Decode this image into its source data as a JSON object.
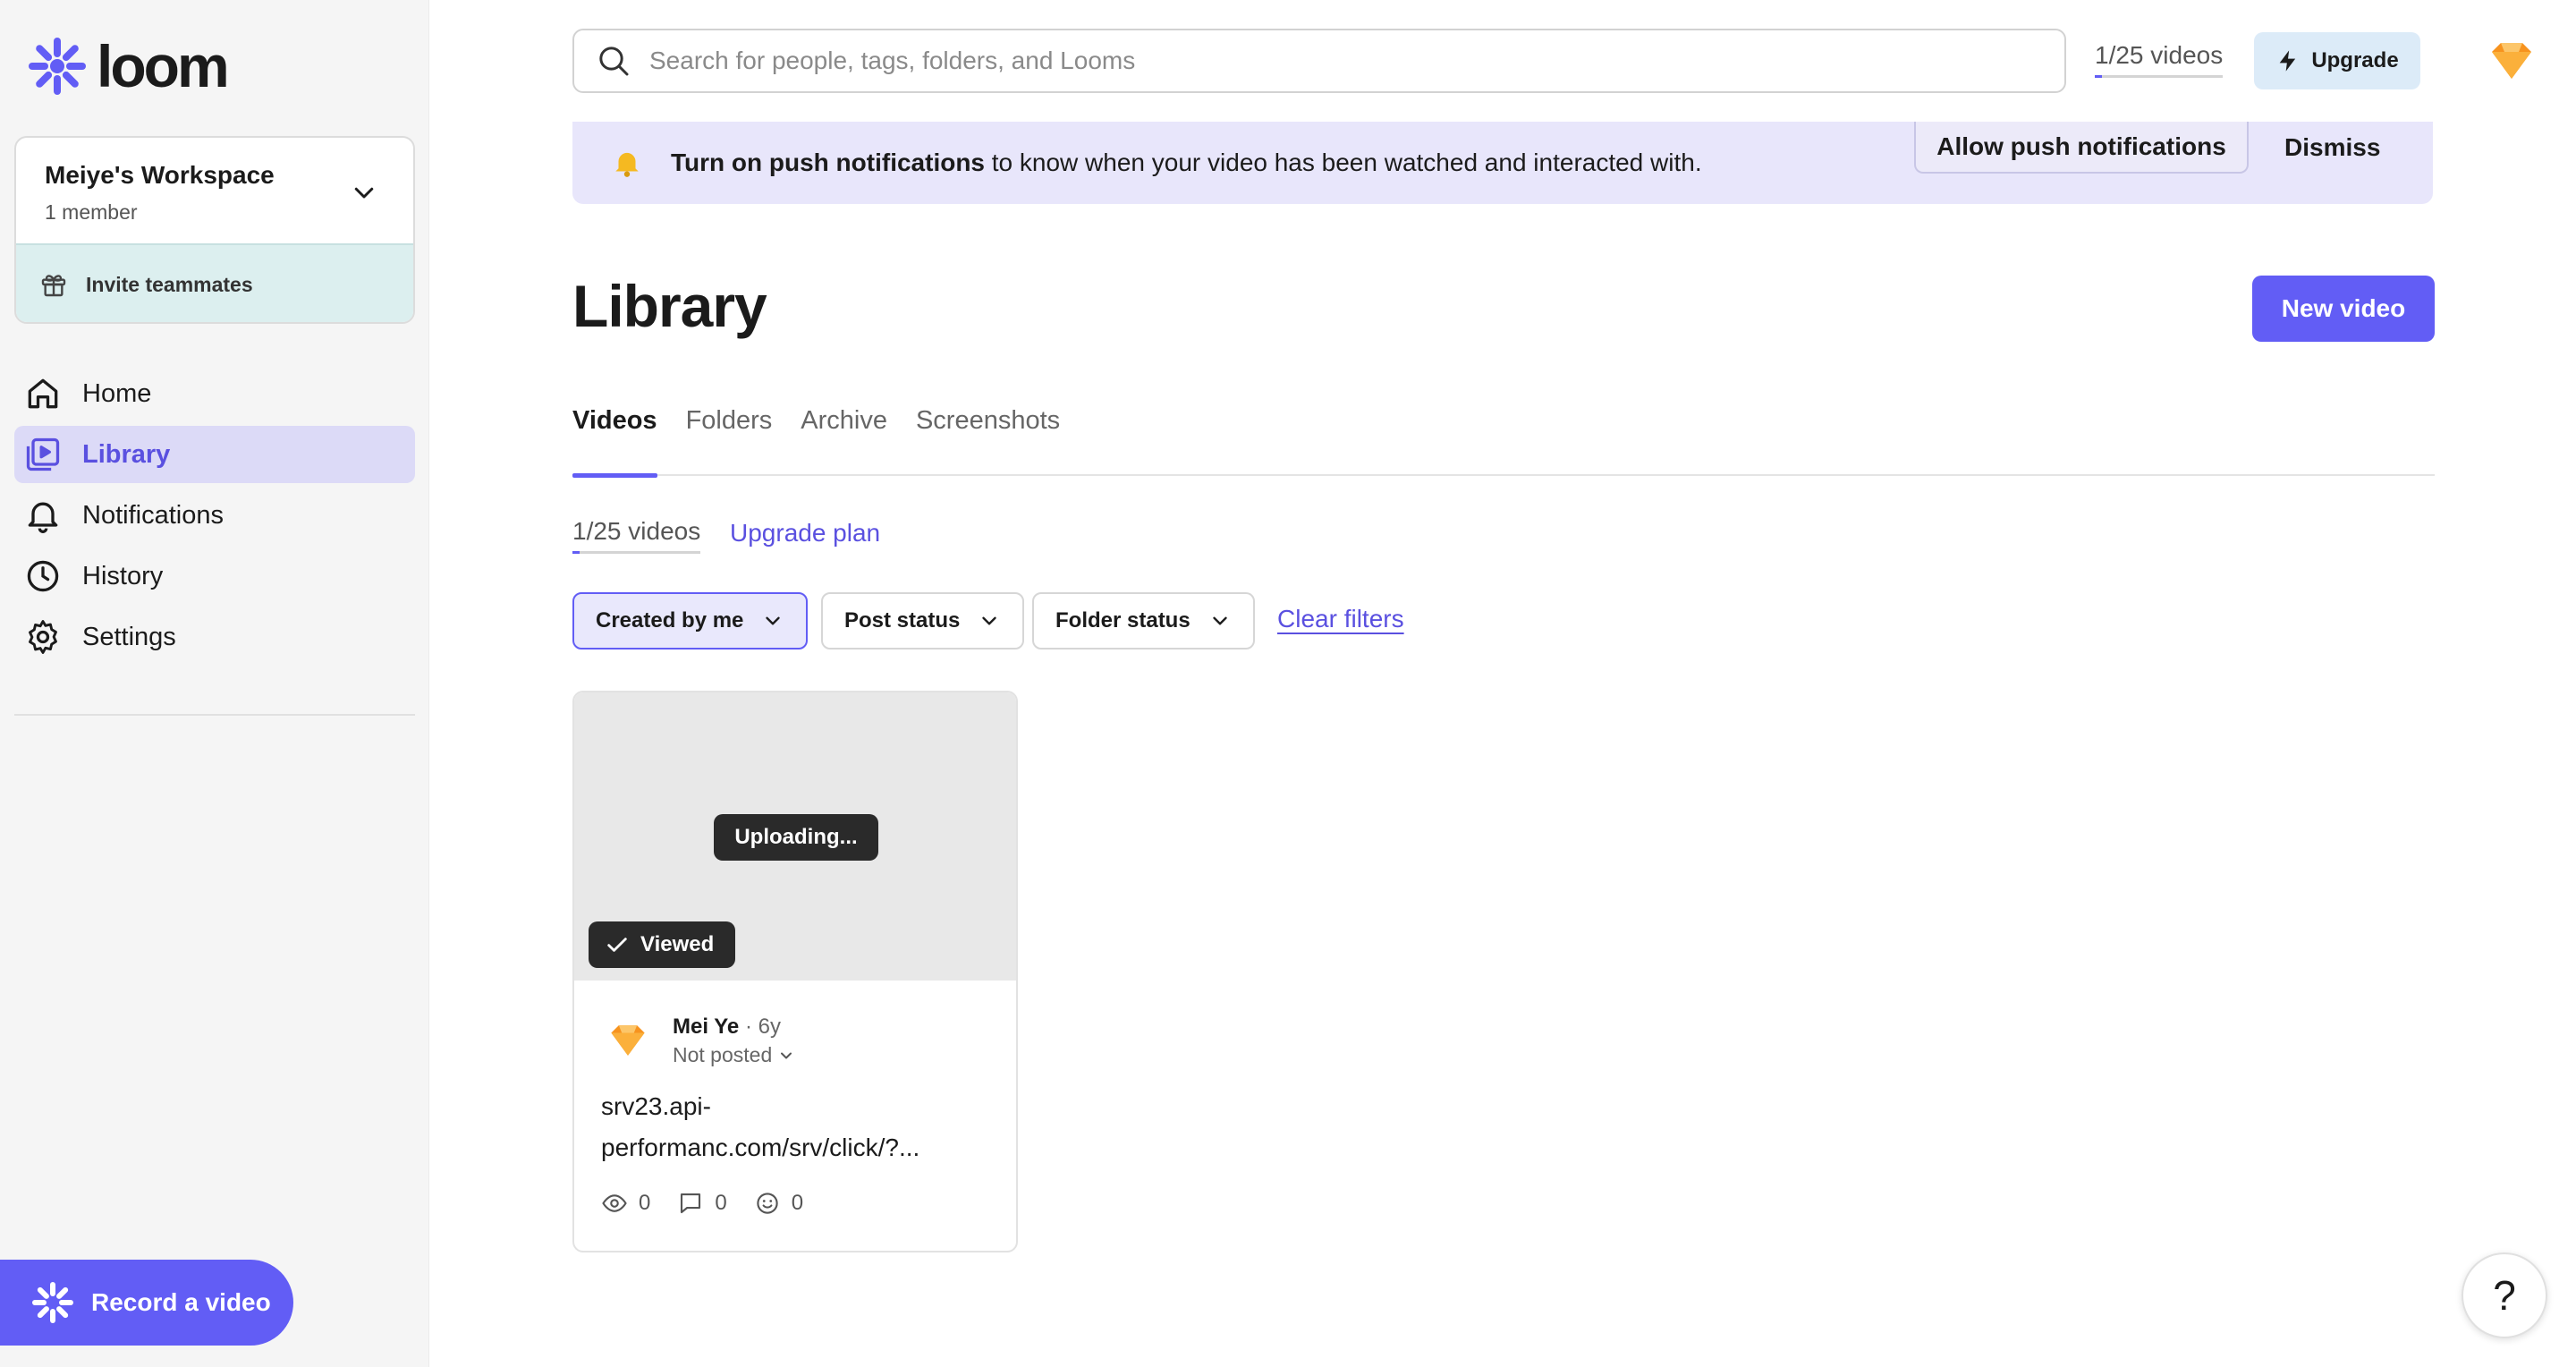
{
  "app": {
    "logo_text": "loom",
    "accent": "#625df5"
  },
  "sidebar": {
    "workspace": {
      "name": "Meiye's Workspace",
      "members": "1 member",
      "invite_label": "Invite teammates"
    },
    "items": [
      {
        "label": "Home",
        "icon": "home-icon"
      },
      {
        "label": "Library",
        "icon": "library-icon",
        "active": true
      },
      {
        "label": "Notifications",
        "icon": "bell-icon"
      },
      {
        "label": "History",
        "icon": "clock-icon"
      },
      {
        "label": "Settings",
        "icon": "gear-icon"
      }
    ],
    "record_label": "Record a video"
  },
  "topbar": {
    "search_placeholder": "Search for people, tags, folders, and Looms",
    "video_count": "1/25 videos",
    "upgrade_label": "Upgrade"
  },
  "banner": {
    "bold": "Turn on push notifications",
    "text": " to know when your video has been watched and interacted with.",
    "allow_label": "Allow push notifications",
    "dismiss_label": "Dismiss"
  },
  "main": {
    "title": "Library",
    "new_video_label": "New video",
    "tabs": [
      {
        "label": "Videos",
        "active": true
      },
      {
        "label": "Folders"
      },
      {
        "label": "Archive"
      },
      {
        "label": "Screenshots"
      }
    ],
    "video_count": "1/25 videos",
    "upgrade_plan_label": "Upgrade plan",
    "filters": [
      {
        "label": "Created by me",
        "active": true
      },
      {
        "label": "Post status"
      },
      {
        "label": "Folder status"
      }
    ],
    "clear_filters_label": "Clear filters"
  },
  "videos": [
    {
      "status_overlay": "Uploading...",
      "viewed_label": "Viewed",
      "author": "Mei Ye",
      "separator": " · ",
      "age": "6y",
      "post_status": "Not posted",
      "title": "srv23.api-performanc.com/srv/click/?...",
      "views": "0",
      "comments": "0",
      "reactions": "0"
    }
  ],
  "help_label": "?"
}
